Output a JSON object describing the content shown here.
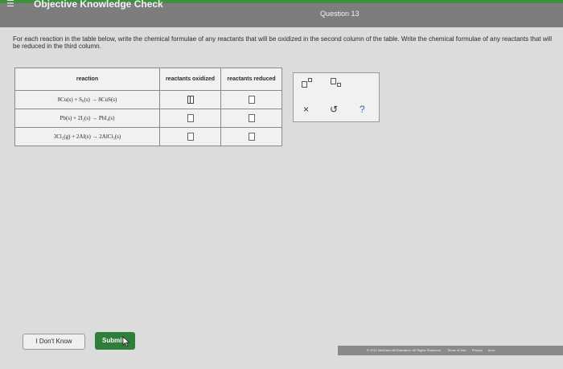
{
  "header": {
    "title": "Objective Knowledge Check",
    "question": "Question 13"
  },
  "instructions": "For each reaction in the table below, write the chemical formulae of any reactants that will be oxidized in the second column of the table. Write the chemical formulae of any reactants that will be reduced in the third column.",
  "table": {
    "headers": [
      "reaction",
      "reactants oxidized",
      "reactants reduced"
    ],
    "rows": [
      {
        "reaction": "8Cu(s) + S₈(s) → 8CuS(s)"
      },
      {
        "reaction": "Pb(s) + 2I₂(s) → PbI₄(s)"
      },
      {
        "reaction": "3Cl₂(g) + 2Al(s) → 2AlCl₃(s)"
      }
    ]
  },
  "toolbar": {
    "superscript": "superscript-icon",
    "subscript": "subscript-icon",
    "clear": "×",
    "undo": "↺",
    "help": "?"
  },
  "buttons": {
    "dont_know": "I Don't Know",
    "submit": "Submit"
  },
  "footer": {
    "copyright": "© 2021 McGraw-Hill Education. All Rights Reserved.",
    "terms": "Terms of Use",
    "privacy": "Privacy",
    "accessibility": "Acce"
  },
  "colors": {
    "header": "#7d7d7d",
    "accent": "#3f8f3f",
    "submit": "#2f7f3b",
    "panel": "#f1f1f1"
  }
}
